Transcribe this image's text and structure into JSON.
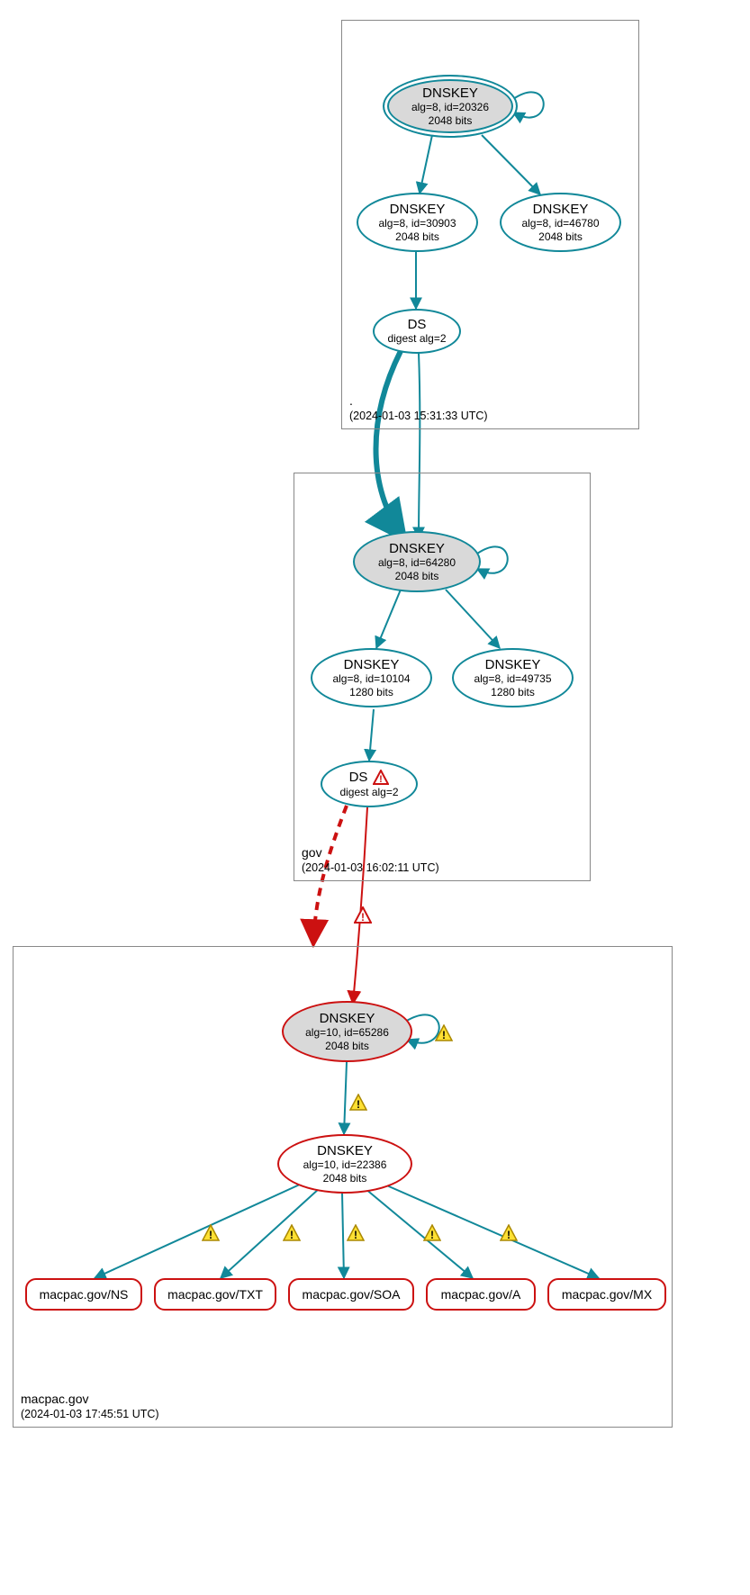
{
  "zones": {
    "root": {
      "name": ".",
      "time": "(2024-01-03 15:31:33 UTC)"
    },
    "gov": {
      "name": "gov",
      "time": "(2024-01-03 16:02:11 UTC)"
    },
    "macpac": {
      "name": "macpac.gov",
      "time": "(2024-01-03 17:45:51 UTC)"
    }
  },
  "nodes": {
    "root_ksk": {
      "title": "DNSKEY",
      "line1": "alg=8, id=20326",
      "line2": "2048 bits"
    },
    "root_zsk1": {
      "title": "DNSKEY",
      "line1": "alg=8, id=30903",
      "line2": "2048 bits"
    },
    "root_zsk2": {
      "title": "DNSKEY",
      "line1": "alg=8, id=46780",
      "line2": "2048 bits"
    },
    "root_ds": {
      "title": "DS",
      "line1": "digest alg=2",
      "line2": ""
    },
    "gov_ksk": {
      "title": "DNSKEY",
      "line1": "alg=8, id=64280",
      "line2": "2048 bits"
    },
    "gov_zsk1": {
      "title": "DNSKEY",
      "line1": "alg=8, id=10104",
      "line2": "1280 bits"
    },
    "gov_zsk2": {
      "title": "DNSKEY",
      "line1": "alg=8, id=49735",
      "line2": "1280 bits"
    },
    "gov_ds": {
      "title": "DS",
      "line1": "digest alg=2",
      "line2": ""
    },
    "mac_ksk": {
      "title": "DNSKEY",
      "line1": "alg=10, id=65286",
      "line2": "2048 bits"
    },
    "mac_zsk": {
      "title": "DNSKEY",
      "line1": "alg=10, id=22386",
      "line2": "2048 bits"
    }
  },
  "rrsets": {
    "ns": "macpac.gov/NS",
    "txt": "macpac.gov/TXT",
    "soa": "macpac.gov/SOA",
    "a": "macpac.gov/A",
    "mx": "macpac.gov/MX"
  }
}
